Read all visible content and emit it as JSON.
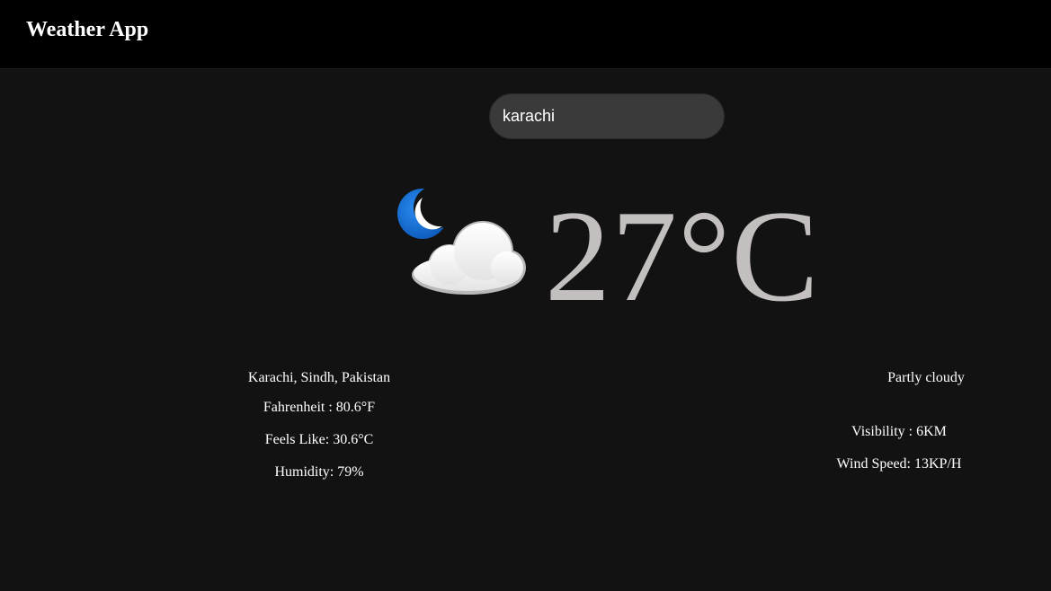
{
  "header": {
    "title": "Weather App"
  },
  "search": {
    "value": "karachi",
    "placeholder": ""
  },
  "current": {
    "icon": "moon-cloud-icon",
    "temperature": "27°C",
    "condition": "Partly cloudy",
    "location": "Karachi, Sindh, Pakistan",
    "fahrenheit": "Fahrenheit : 80.6°F",
    "feels_like": "Feels Like: 30.6°C",
    "humidity": "Humidity: 79%",
    "visibility": "Visibility : 6KM",
    "wind_speed": "Wind Speed: 13KP/H"
  },
  "colors": {
    "background": "#121212",
    "header": "#000000",
    "search_bg": "#3a3a3a",
    "temperature": "#c4bfbf",
    "moon": "#1a6fd6"
  }
}
